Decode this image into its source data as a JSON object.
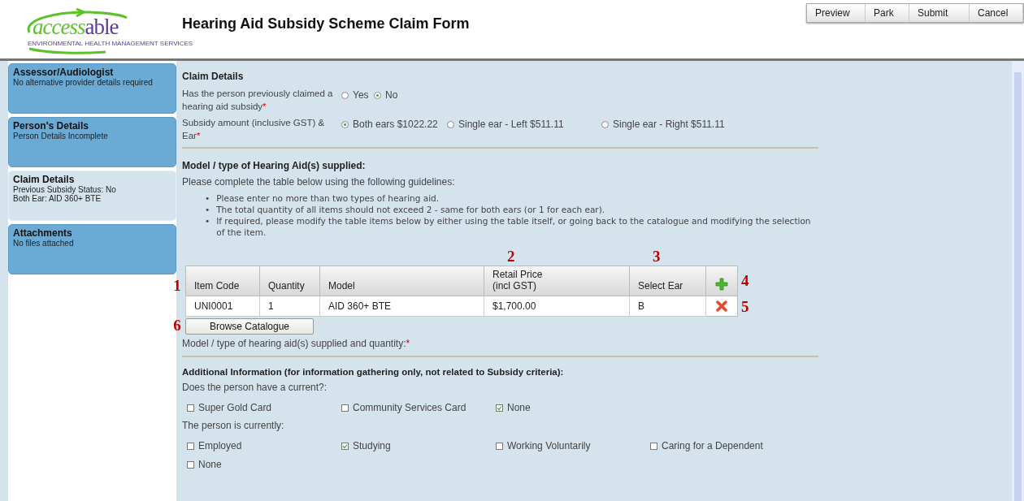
{
  "header": {
    "logo": {
      "word_a": "access",
      "word_b": "able",
      "tagline": "ENVIRONMENTAL HEALTH MANAGEMENT SERVICES"
    },
    "title": "Hearing Aid Subsidy Scheme Claim Form",
    "buttons": [
      "Preview",
      "Park",
      "Submit",
      "Cancel"
    ]
  },
  "sidebar": {
    "items": [
      {
        "title": "Assessor/Audiologist",
        "lines": [
          "No alternative provider details required"
        ],
        "selected": false
      },
      {
        "title": "Person's Details",
        "lines": [
          "Person Details Incomplete"
        ],
        "selected": false
      },
      {
        "title": "Claim Details",
        "lines": [
          "Previous Subsidy Status: No",
          "Both Ear: AID 360+ BTE"
        ],
        "selected": true
      },
      {
        "title": "Attachments",
        "lines": [
          "No files attached"
        ],
        "selected": false
      }
    ]
  },
  "claim_details": {
    "heading": "Claim Details",
    "questions": [
      {
        "label": "Has the person previously claimed a hearing aid subsidy",
        "required_mark": "*",
        "options": [
          {
            "label": "Yes",
            "selected": false
          },
          {
            "label": "No",
            "selected": true
          }
        ]
      },
      {
        "label": "Subsidy amount (inclusive GST) & Ear",
        "required_mark": "*",
        "options": [
          {
            "label": "Both ears $1022.22",
            "selected": true
          },
          {
            "label": "Single ear - Left $511.11",
            "selected": false
          },
          {
            "label": "Single ear - Right $511.11",
            "selected": false
          }
        ]
      }
    ]
  },
  "model_section": {
    "heading": "Model / type of Hearing Aid(s) supplied:",
    "intro": "Please complete the table below using the following guidelines:",
    "bullet": "•",
    "guidelines": [
      "Please enter no more than two types of hearing aid.",
      "The total quantity of all items should not exceed 2 - same for both ears (or 1 for each ear).",
      "If required, please modify the table items below by either using the table itself, or going back to the catalogue and modifying the selection of the item."
    ],
    "table": {
      "callout": "1",
      "columns": [
        {
          "label": "Item Code"
        },
        {
          "label": "Quantity"
        },
        {
          "label": "Model"
        },
        {
          "label": "Retail Price\n(incl GST)",
          "callout": "2"
        },
        {
          "label": "Select Ear",
          "callout": "3"
        }
      ],
      "add_callout": "4",
      "rows": [
        {
          "cells": [
            "UNI0001",
            "1",
            "AID 360+ BTE",
            "$1,700.00",
            "B"
          ],
          "remove_callout": "5"
        }
      ]
    },
    "browse_button": {
      "label": "Browse Catalogue",
      "callout": "6"
    },
    "summary_label": "Model / type of hearing aid(s) supplied and quantity:",
    "summary_required_mark": "*"
  },
  "additional": {
    "heading": "Additional Information (for information gathering only, not related to Subsidy criteria):",
    "groups": [
      {
        "question": "Does the person have a current?:",
        "options": [
          {
            "label": "Super Gold Card",
            "checked": false
          },
          {
            "label": "Community Services Card",
            "checked": false
          },
          {
            "label": "None",
            "checked": true
          }
        ]
      },
      {
        "question": "The person is currently:",
        "options": [
          {
            "label": "Employed",
            "checked": false
          },
          {
            "label": "Studying",
            "checked": true
          },
          {
            "label": "Working Voluntarily",
            "checked": false
          },
          {
            "label": "Caring for a Dependent",
            "checked": false
          },
          {
            "label": "None",
            "checked": false
          }
        ]
      }
    ]
  }
}
